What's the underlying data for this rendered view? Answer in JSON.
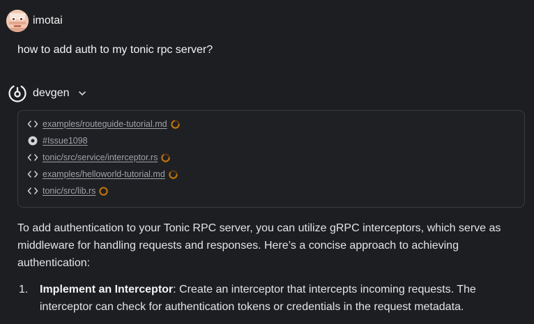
{
  "user": {
    "name": "imotai",
    "avatar_icon": "pixel-avatar-icon"
  },
  "question": "how to add auth to my tonic rpc server?",
  "assistant": {
    "name": "devgen",
    "logo_icon": "devgen-logo-icon",
    "toggle_icon": "chevron-down-icon"
  },
  "context": {
    "items": [
      {
        "icon": "code-brackets-icon",
        "label": "examples/routeguide-tutorial.md",
        "status": "loading-spinner-icon"
      },
      {
        "icon": "issue-icon",
        "label": "#Issue1098",
        "status": ""
      },
      {
        "icon": "code-brackets-icon",
        "label": "tonic/src/service/interceptor.rs",
        "status": "loading-spinner-icon"
      },
      {
        "icon": "code-brackets-icon",
        "label": "examples/helloworld-tutorial.md",
        "status": "loading-spinner-icon"
      },
      {
        "icon": "code-brackets-icon",
        "label": "tonic/src/lib.rs",
        "status": "loading-spinner-icon"
      }
    ],
    "spinner_color": "#c2750f"
  },
  "answer": {
    "intro": "To add authentication to your Tonic RPC server, you can utilize gRPC interceptors, which serve as middleware for handling requests and responses. Here’s a concise approach to achieving authentication:",
    "steps": [
      {
        "number": "1.",
        "title": "Implement an Interceptor",
        "text": ": Create an interceptor that intercepts incoming requests. The interceptor can check for authentication tokens or credentials in the request metadata."
      }
    ]
  }
}
